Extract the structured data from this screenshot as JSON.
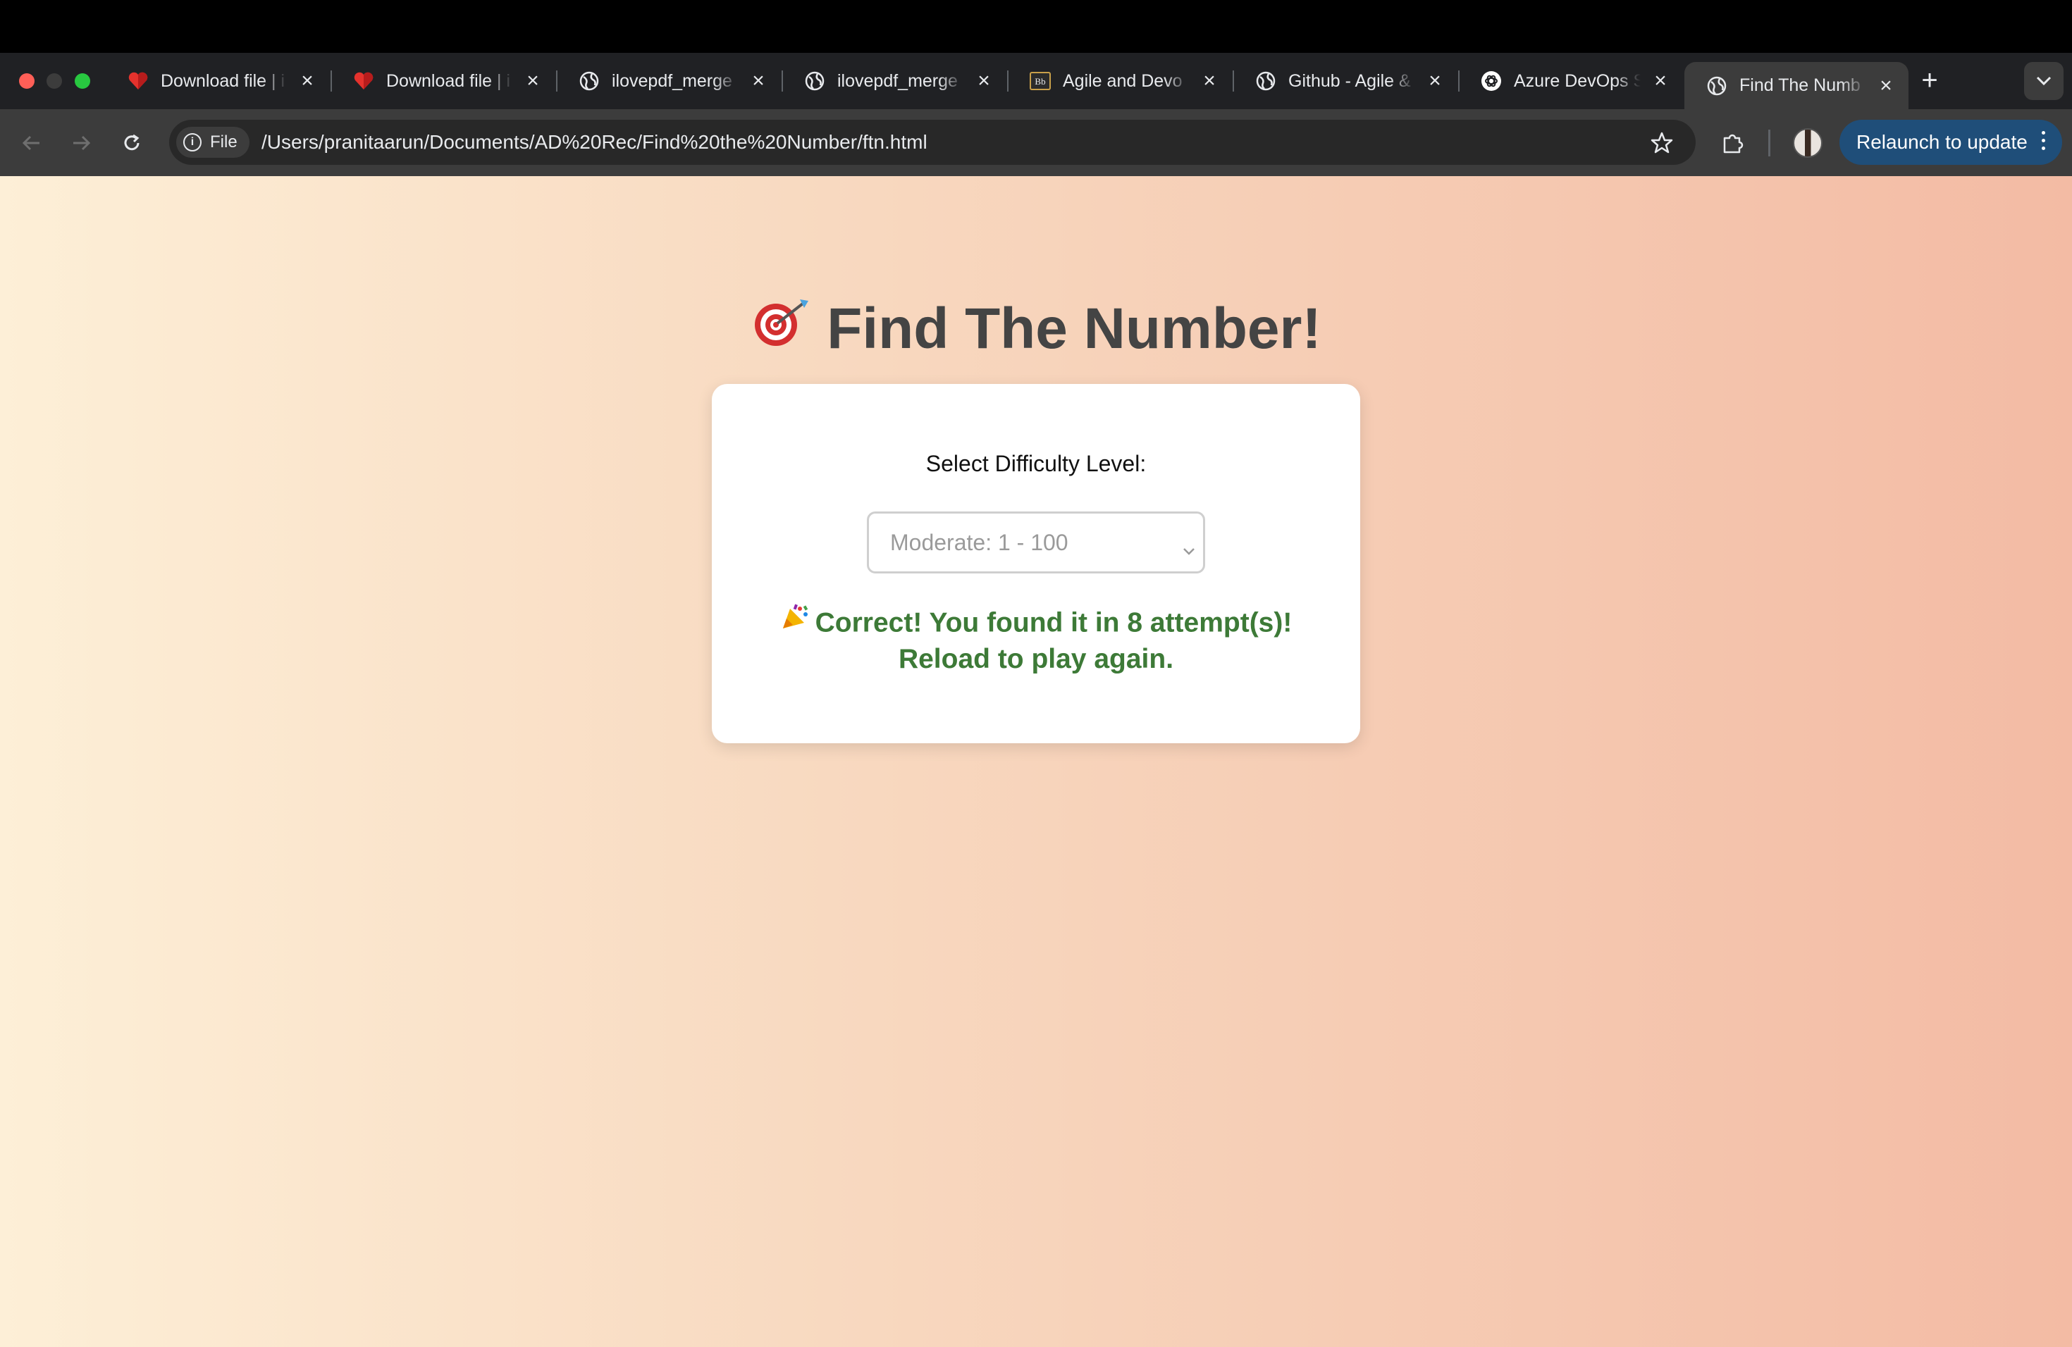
{
  "browser": {
    "tabs": [
      {
        "title": "Download file | i",
        "icon": "pdf-heart-icon",
        "active": false
      },
      {
        "title": "Download file | i",
        "icon": "pdf-heart-icon",
        "active": false
      },
      {
        "title": "ilovepdf_merge",
        "icon": "globe-icon",
        "active": false
      },
      {
        "title": "ilovepdf_merge",
        "icon": "globe-icon",
        "active": false
      },
      {
        "title": "Agile and Devo",
        "icon": "blackboard-icon",
        "active": false
      },
      {
        "title": "Github - Agile &",
        "icon": "globe-icon",
        "active": false
      },
      {
        "title": "Azure DevOps S",
        "icon": "openai-icon",
        "active": false
      },
      {
        "title": "Find The Numb",
        "icon": "globe-icon",
        "active": true
      }
    ],
    "site_chip": "File",
    "url": "/Users/pranitaarun/Documents/AD%20Rec/Find%20the%20Number/ftn.html",
    "relaunch_label": "Relaunch to update"
  },
  "page": {
    "title": "Find The Number!",
    "title_emoji": "target-dart-icon",
    "difficulty_label": "Select Difficulty Level:",
    "difficulty_selected": "Moderate: 1 - 100",
    "result_line1": "Correct! You found it in 8 attempt(s)!",
    "result_line2": "Reload to play again.",
    "result_emoji": "party-popper-icon"
  },
  "colors": {
    "accent_button": "#1f4e79",
    "success_text": "#3d7a37",
    "title_text": "#444444",
    "background_start": "#fdefd7",
    "background_end": "#f3bba4"
  }
}
